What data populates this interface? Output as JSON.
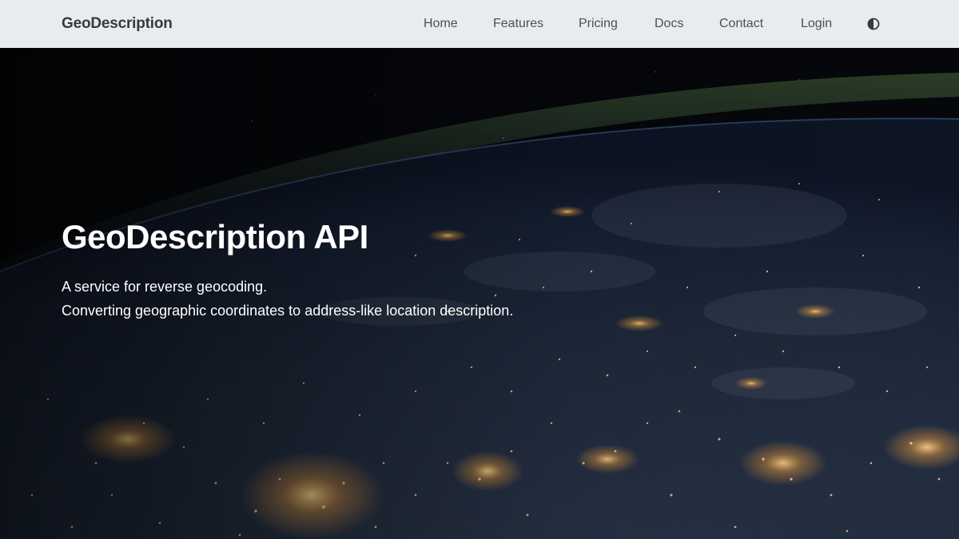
{
  "navbar": {
    "brand": "GeoDescription",
    "links": [
      {
        "label": "Home"
      },
      {
        "label": "Features"
      },
      {
        "label": "Pricing"
      },
      {
        "label": "Docs"
      },
      {
        "label": "Contact"
      },
      {
        "label": "Login"
      }
    ],
    "theme_toggle_icon": "contrast-icon",
    "background": "#e9ecef",
    "text_color": "#495057"
  },
  "hero": {
    "background_image": "earth-at-night-from-space",
    "title": "GeoDescription API",
    "subtitle_lines": [
      "A service for reverse geocoding.",
      "Converting geographic coordinates to address-like location description."
    ],
    "text_color": "#ffffff",
    "city_light_color": "#ffcf7a"
  }
}
